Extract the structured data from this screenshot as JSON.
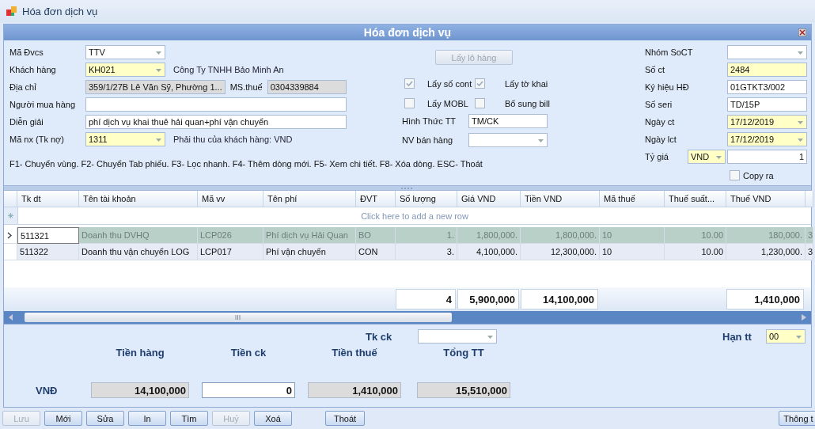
{
  "window": {
    "title": "Hóa đơn dịch vụ"
  },
  "header": {
    "title": "Hóa đơn dịch vụ"
  },
  "left_fields": [
    {
      "label": "Mã Đvcs",
      "value": "TTV",
      "kind": "combo",
      "highlighted": false
    },
    {
      "label": "Khách hàng",
      "value": "KH021",
      "kind": "combo",
      "highlighted": true,
      "note": "Công Ty TNHH Bảo Minh An"
    },
    {
      "label": "Địa chỉ",
      "value": "359/1/27B Lê Văn Sỹ, Phường 1...",
      "kind": "readonly",
      "extra_label": "MS.thuế",
      "extra_value": "0304339884"
    },
    {
      "label": "Người mua hàng",
      "kind": "wide"
    },
    {
      "label": "Diễn giải",
      "value": "phí dịch vụ khai thuê hải quan+phí vận chuyển",
      "kind": "wide"
    },
    {
      "label": "Mã nx (Tk nợ)",
      "value": "1311",
      "kind": "combo",
      "highlighted": true,
      "note": "Phải thu của khách hàng: VND"
    }
  ],
  "hotkeys": "F1- Chuyển vùng. F2- Chuyển Tab phiếu. F3- Lọc nhanh. F4- Thêm dòng mới. F5- Xem chi tiết. F8- Xóa dòng. ESC- Thoát",
  "fetch_button": {
    "label": "Lấy lô hàng",
    "disabled": true
  },
  "checkboxes": [
    {
      "label": "Lấy số cont",
      "checked": true
    },
    {
      "label": "Lấy tờ khai",
      "checked": true
    },
    {
      "label": "Lấy MOBL",
      "checked": false
    },
    {
      "label": "Bổ sung bill",
      "checked": false
    }
  ],
  "middle_fields": [
    {
      "label": "Hình Thức TT",
      "value": "TM/CK",
      "kind": "text"
    },
    {
      "label": "NV bán hàng",
      "kind": "combo"
    }
  ],
  "right_fields": [
    {
      "label": "Nhóm SoCT",
      "kind": "combo",
      "highlighted": false
    },
    {
      "label": "Số ct",
      "value": "2484",
      "kind": "text",
      "highlighted": true
    },
    {
      "label": "Ký hiệu HĐ",
      "value": "01GTKT3/002",
      "kind": "text",
      "highlighted": false
    },
    {
      "label": "Số seri",
      "value": "TD/15P",
      "kind": "text",
      "highlighted": false
    },
    {
      "label": "Ngày ct",
      "value": "17/12/2019",
      "kind": "combo",
      "highlighted": true
    },
    {
      "label": "Ngày lct",
      "value": "17/12/2019",
      "kind": "combo",
      "highlighted": true
    }
  ],
  "exchange_rate": {
    "label": "Tỷ giá",
    "currency": "VND",
    "value": "1"
  },
  "copy_out": {
    "label": "Copy ra",
    "checked": false
  },
  "table": {
    "columns": [
      {
        "label": "Tk dt"
      },
      {
        "label": "Tên tài khoản"
      },
      {
        "label": "Mã vv"
      },
      {
        "label": "Tên phí"
      },
      {
        "label": "ĐVT"
      },
      {
        "label": "Số lượng",
        "total": "4"
      },
      {
        "label": "Giá VND",
        "total": "5,900,000"
      },
      {
        "label": "Tiền VND",
        "total": "14,100,000"
      },
      {
        "label": "Mã thuế"
      },
      {
        "label": "Thuế suất..."
      },
      {
        "label": "Thuế VND",
        "total": "1,410,000"
      }
    ],
    "new_row_hint": "Click here to add a new row",
    "rows": [
      {
        "selected": true,
        "cells": [
          "511321",
          "Doanh thu DVHQ",
          "LCP026",
          "Phí dịch vụ Hải Quan",
          "BO",
          "1.",
          "1,800,000.",
          "1,800,000.",
          "10",
          "10.00",
          "180,000.",
          "3"
        ]
      },
      {
        "selected": false,
        "cells": [
          "511322",
          "Doanh thu vận chuyển LOG",
          "LCP017",
          "Phí vận chuyển",
          "CON",
          "3.",
          "4,100,000.",
          "12,300,000.",
          "10",
          "10.00",
          "1,230,000.",
          "3"
        ]
      }
    ]
  },
  "summary": {
    "tk_ck_label": "Tk ck",
    "han_tt": {
      "label": "Hạn tt",
      "value": "00"
    },
    "currency": "VNĐ",
    "columns": [
      {
        "label": "Tiền hàng",
        "value": "14,100,000",
        "editable": false
      },
      {
        "label": "Tiền ck",
        "value": "0",
        "editable": true
      },
      {
        "label": "Tiền thuế",
        "value": "1,410,000",
        "editable": false
      },
      {
        "label": "Tổng TT",
        "value": "15,510,000",
        "editable": false
      }
    ]
  },
  "buttons": [
    {
      "label": "Lưu",
      "disabled": true
    },
    {
      "label": "Mới",
      "disabled": false
    },
    {
      "label": "Sửa",
      "disabled": false
    },
    {
      "label": "In",
      "disabled": false
    },
    {
      "label": "Tìm",
      "disabled": false
    },
    {
      "label": "Huỷ",
      "disabled": true
    },
    {
      "label": "Xoá",
      "disabled": false
    }
  ],
  "exit_button": {
    "label": "Thoát"
  },
  "info_button": {
    "label": "Thông t"
  }
}
